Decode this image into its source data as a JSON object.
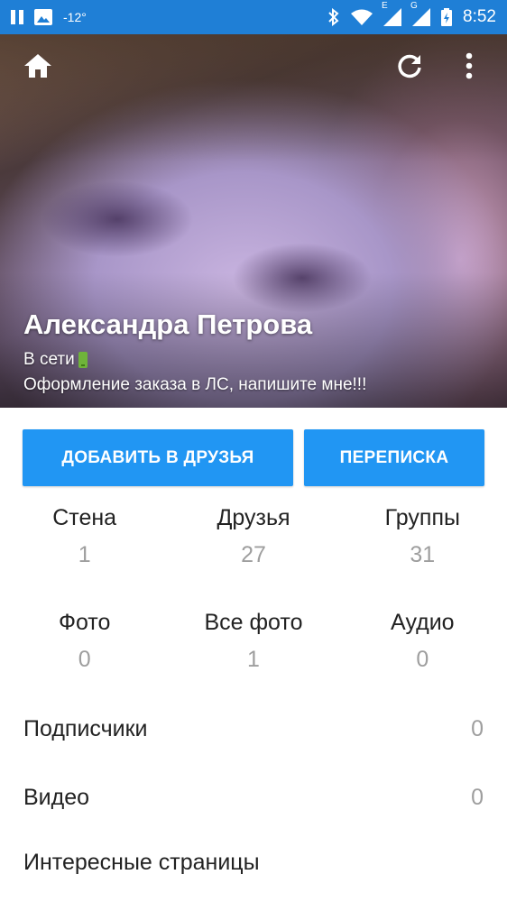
{
  "status_bar": {
    "temperature": "-12°",
    "network_label_1": "E",
    "network_label_2": "G",
    "time": "8:52"
  },
  "header": {
    "icons": [
      "home-icon",
      "refresh-icon",
      "more-vert-icon"
    ]
  },
  "profile": {
    "name": "Александра Петрова",
    "status": "В сети",
    "description": "Оформление заказа в ЛС, напишите мне!!!"
  },
  "actions": {
    "add_friend": "ДОБАВИТЬ В ДРУЗЬЯ",
    "messages": "ПЕРЕПИСКА"
  },
  "stats": {
    "row1": [
      {
        "label": "Стена",
        "value": "1"
      },
      {
        "label": "Друзья",
        "value": "27"
      },
      {
        "label": "Группы",
        "value": "31"
      }
    ],
    "row2": [
      {
        "label": "Фото",
        "value": "0"
      },
      {
        "label": "Все фото",
        "value": "1"
      },
      {
        "label": "Аудио",
        "value": "0"
      }
    ]
  },
  "list": [
    {
      "label": "Подписчики",
      "value": "0"
    },
    {
      "label": "Видео",
      "value": "0"
    },
    {
      "label": "Интересные страницы",
      "value": ""
    }
  ],
  "colors": {
    "status_bar": "#1f7fd6",
    "accent_button": "#2196f3",
    "online_indicator": "#6fb33a"
  }
}
